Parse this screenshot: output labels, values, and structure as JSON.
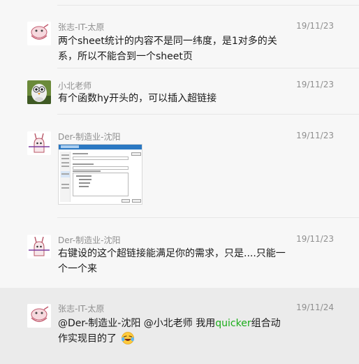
{
  "chat": {
    "messages": [
      {
        "sender": "张志-IT-太原",
        "time": "19/11/23",
        "lines": [
          "两个sheet统计的内容不是同一纬度，是1对多的关",
          "系，所以不能合到一个sheet页"
        ]
      },
      {
        "sender": "小北老师",
        "time": "19/11/23",
        "lines": [
          "有个函数hy开头的，可以插入超链接"
        ]
      },
      {
        "sender": "Der-制造业-沈阳",
        "time": "19/11/23",
        "attachment": "image"
      },
      {
        "sender": "Der-制造业-沈阳",
        "time": "19/11/23",
        "lines": [
          "右键设的这个超链接能满足你的需求，只是....只能一",
          "个一个来"
        ]
      },
      {
        "sender": "张志-IT-太原",
        "time": "19/11/24",
        "highlighted": true,
        "line1_before": "@Der-制造业-沈阳 @小北老师 我用",
        "line1_keyword": "quicker",
        "line1_after": "组合动",
        "line2": "作实现目的了",
        "emoji": "laughing-crying-emoji",
        "keyword_color": "#1aad19"
      }
    ]
  }
}
